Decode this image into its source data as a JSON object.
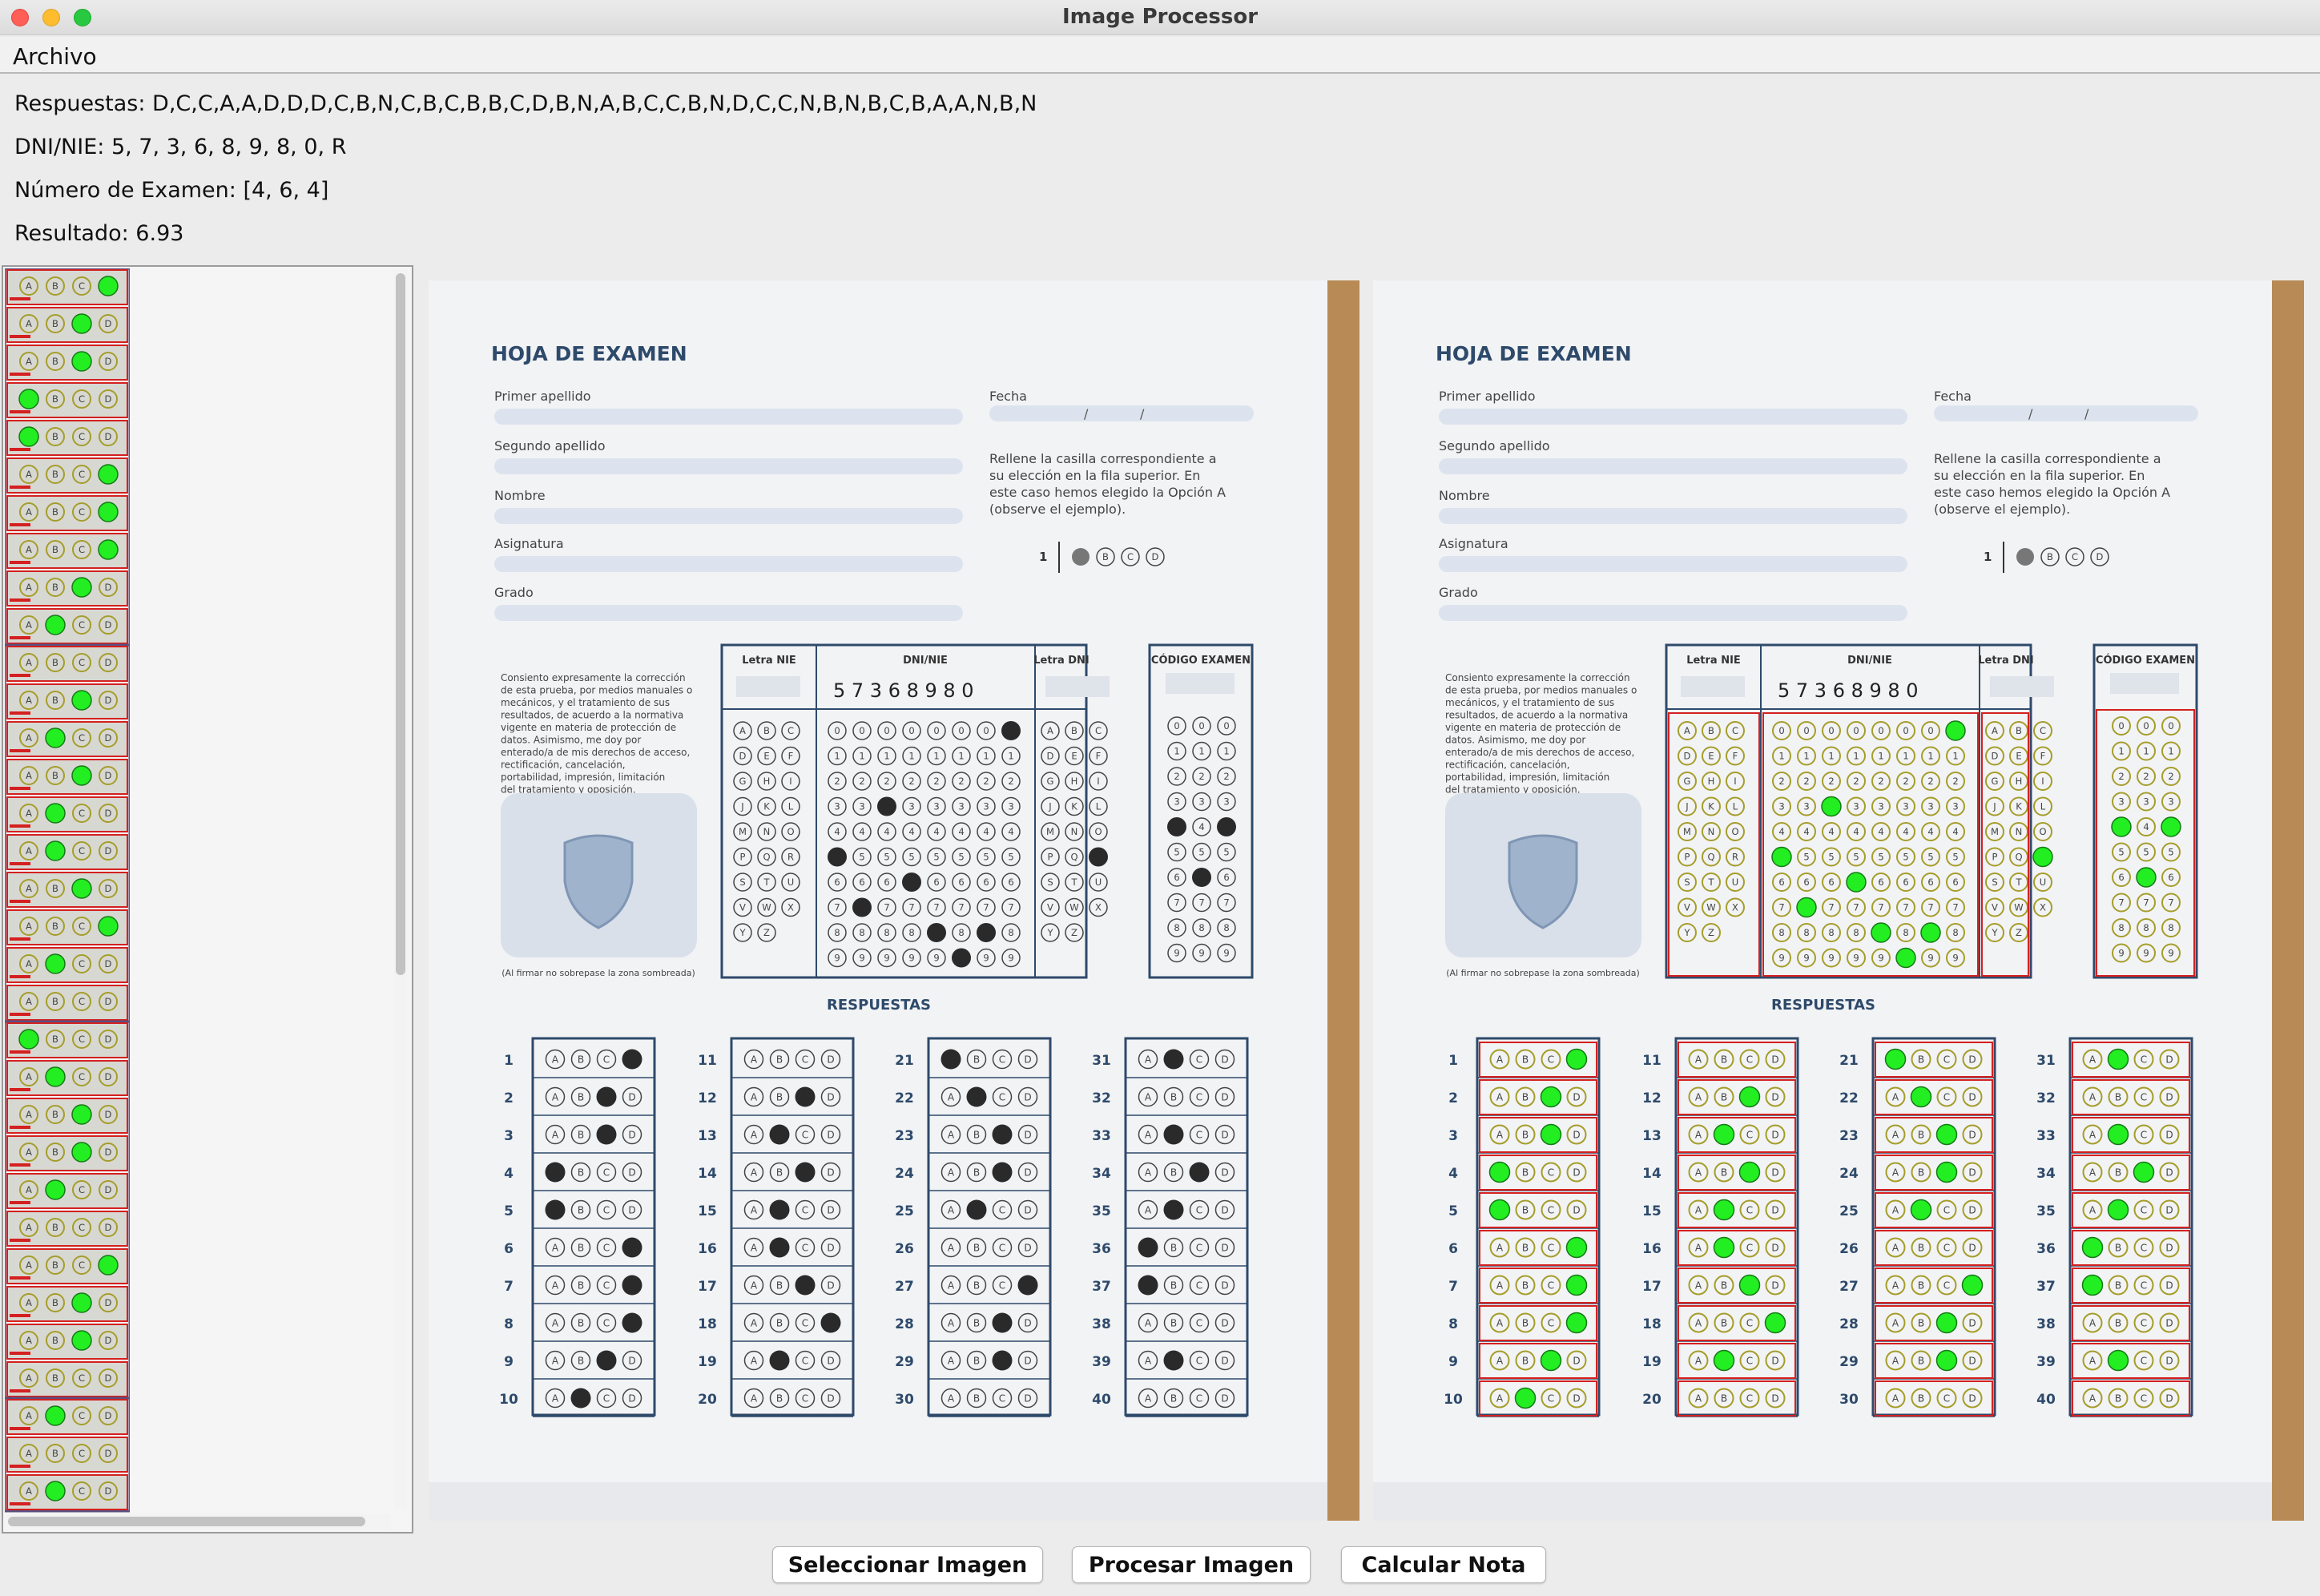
{
  "window": {
    "title": "Image Processor"
  },
  "menu": {
    "file": "Archivo"
  },
  "info": {
    "answers": "Respuestas: D,C,C,A,A,D,D,D,C,B,N,C,B,C,B,B,C,D,B,N,A,B,C,C,B,N,D,C,C,N,B,N,B,C,B,A,A,N,B,N",
    "dni": "DNI/NIE: 5, 7, 3, 6, 8, 9, 8, 0, R",
    "exam_number": "Número de Examen: [4, 6, 4]",
    "result": "Resultado: 6.93"
  },
  "buttons": {
    "select": "Seleccionar Imagen",
    "process": "Procesar Imagen",
    "grade": "Calcular Nota"
  },
  "sheet": {
    "title": "HOJA DE EXAMEN",
    "first_surname": "Primer apellido",
    "second_surname": "Segundo apellido",
    "name": "Nombre",
    "subject": "Asignatura",
    "degree": "Grado",
    "date": "Fecha",
    "instructions": "Rellene la casilla correspondiente a su elección en la fila superior. En este caso hemos elegido la Opción A (observe el ejemplo).",
    "consent": "Consiento expresamente la corrección de esta prueba, por medios manuales o mecánicos, y el tratamiento de sus resultados, de acuerdo a la normativa vigente en materia de protección de datos. Asimismo, me doy por enterado/a de mis derechos de acceso, rectificación, cancelación, portabilidad, impresión, limitación del tratamiento y oposición.",
    "signature_note": "(Al firmar no sobrepase la zona sombreada)",
    "letter_nie": "Letra NIE",
    "dni_nie": "DNI/NIE",
    "letter_dni": "Letra DNI",
    "exam_code": "CÓDIGO EXAMEN",
    "answers_heading": "RESPUESTAS",
    "handwritten_dni": "5 7 3 6 8 9 8 0"
  },
  "answer_key": [
    "D",
    "C",
    "C",
    "A",
    "A",
    "D",
    "D",
    "D",
    "C",
    "B",
    "N",
    "C",
    "B",
    "C",
    "B",
    "B",
    "C",
    "D",
    "B",
    "N",
    "A",
    "B",
    "C",
    "C",
    "B",
    "N",
    "D",
    "C",
    "C",
    "N",
    "B",
    "N",
    "B",
    "C",
    "B",
    "A",
    "A",
    "N",
    "B",
    "N"
  ],
  "colors": {
    "highlight": "#22ee22",
    "detect_box": "#d42020",
    "ink": "#2a2a2a",
    "sheet_blue": "#2e4a6b"
  }
}
